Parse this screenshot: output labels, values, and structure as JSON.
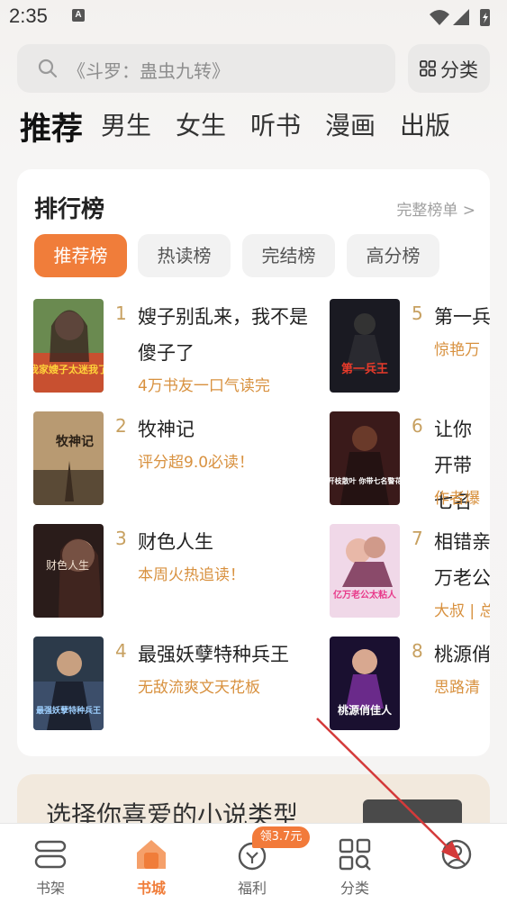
{
  "status": {
    "time": "2:35",
    "badge": "A"
  },
  "search": {
    "placeholder": "《斗罗：蛊虫九转》",
    "category_label": "分类"
  },
  "top_tabs": [
    "推荐",
    "男生",
    "女生",
    "听书",
    "漫画",
    "出版"
  ],
  "ranking": {
    "title": "排行榜",
    "more": "完整榜单 >",
    "tabs": [
      "推荐榜",
      "热读榜",
      "完结榜",
      "高分榜"
    ],
    "books": [
      {
        "rank": "1",
        "title": "嫂子别乱来，我不是傻子了",
        "tag": "4万书友一口气读完",
        "cover_text": "我家嫂子太迷我了"
      },
      {
        "rank": "2",
        "title": "牧神记",
        "tag": "评分超9.0必读！",
        "cover_text": "牧神记"
      },
      {
        "rank": "3",
        "title": "财色人生",
        "tag": "本周火热追读！",
        "cover_text": "财色人生"
      },
      {
        "rank": "4",
        "title": "最强妖孽特种兵王",
        "tag": "无敌流爽文天花板",
        "cover_text": "最强妖孽特种兵王"
      },
      {
        "rank": "5",
        "title": "第一兵",
        "tag": "惊艳万",
        "cover_text": "第一兵王"
      },
      {
        "rank": "6",
        "title": "让你开带七名",
        "tag": "作者爆",
        "cover_text": "让你开枝散叶 你带七名警花逃婚"
      },
      {
        "rank": "7",
        "title": "相错亲万老公",
        "tag": "大叔 | 总",
        "cover_text": "亿万老公太粘人"
      },
      {
        "rank": "8",
        "title": "桃源俏",
        "tag": "思路清",
        "cover_text": "桃源俏佳人"
      }
    ]
  },
  "promo": {
    "text": "选择你喜爱的小说类型"
  },
  "bottom_nav": {
    "items": [
      "书架",
      "书城",
      "福利",
      "分类",
      ""
    ],
    "welfare_badge": "领3.7元"
  },
  "colors": {
    "accent": "#f07d3a",
    "tag": "#d8913f",
    "rank_num": "#c7a060",
    "annotation_arrow": "#d43a3a"
  }
}
